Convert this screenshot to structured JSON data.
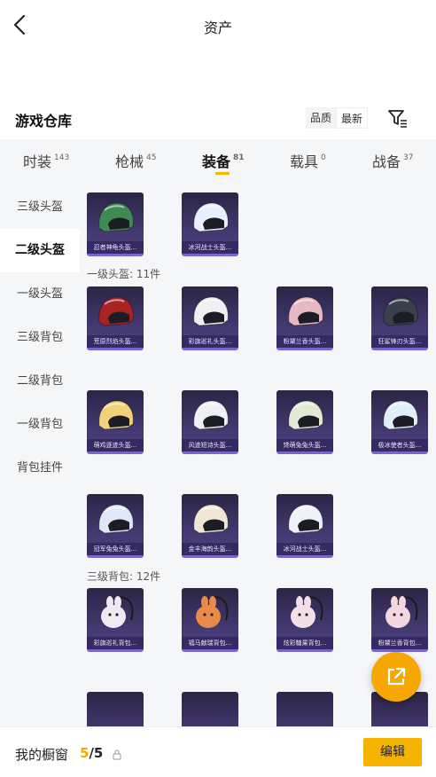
{
  "header": {
    "title": "资产"
  },
  "warehouse": {
    "title": "游戏仓库",
    "sort_quality": "品质",
    "sort_latest": "最新"
  },
  "tabs": [
    {
      "label": "时装",
      "count": "143"
    },
    {
      "label": "枪械",
      "count": "45"
    },
    {
      "label": "装备",
      "count": "81"
    },
    {
      "label": "载具",
      "count": "0"
    },
    {
      "label": "战备",
      "count": "37"
    }
  ],
  "sidebar": [
    {
      "label": "三级头盔"
    },
    {
      "label": "二级头盔"
    },
    {
      "label": "一级头盔"
    },
    {
      "label": "三级背包"
    },
    {
      "label": "二级背包"
    },
    {
      "label": "一级背包"
    },
    {
      "label": "背包挂件"
    }
  ],
  "sections": [
    {
      "label": "一级头盔: 11件"
    },
    {
      "label": "三级背包: 12件"
    }
  ],
  "items": [
    {
      "name": "忍者神龟头盔...",
      "kind": "helmet",
      "color": "#3f8a55"
    },
    {
      "name": "冰河战士头盔...",
      "kind": "helmet",
      "color": "#e8f0ff"
    },
    {
      "name": "荒原烈焰头盔...",
      "kind": "helmet",
      "color": "#a82424"
    },
    {
      "name": "彩旗巡礼头盔...",
      "kind": "helmet",
      "color": "#f0f0f2"
    },
    {
      "name": "粉黛兰香头盔...",
      "kind": "helmet",
      "color": "#e8b9c4"
    },
    {
      "name": "狂鲨锋刃头盔...",
      "kind": "helmet",
      "color": "#3a3f4c"
    },
    {
      "name": "萌鸡逐迹头盔...",
      "kind": "helmet",
      "color": "#f1d27a"
    },
    {
      "name": "风迹短诗头盔...",
      "kind": "helmet",
      "color": "#eef0f4"
    },
    {
      "name": "馋萌兔兔头盔...",
      "kind": "helmet",
      "color": "#e2ead5"
    },
    {
      "name": "极冰使者头盔...",
      "kind": "helmet",
      "color": "#dff0f8"
    },
    {
      "name": "冠军兔兔头盔...",
      "kind": "helmet",
      "color": "#dfe8f8"
    },
    {
      "name": "金丰海韵头盔...",
      "kind": "helmet",
      "color": "#efe6d6"
    },
    {
      "name": "冰河战士头盔...",
      "kind": "helmet",
      "color": "#eef2fb"
    },
    {
      "name": "彩旗巡礼背包...",
      "kind": "bag",
      "color": "#eeeaf0"
    },
    {
      "name": "福马献瑞背包...",
      "kind": "bag",
      "color": "#e88a4a"
    },
    {
      "name": "炫彩糖果背包...",
      "kind": "bag",
      "color": "#f3e0e6"
    },
    {
      "name": "粉黛兰香背包...",
      "kind": "bag",
      "color": "#f2d8de"
    }
  ],
  "showcase": {
    "label": "我的橱窗",
    "current": "5",
    "total": "/5",
    "edit_label": "编辑"
  }
}
